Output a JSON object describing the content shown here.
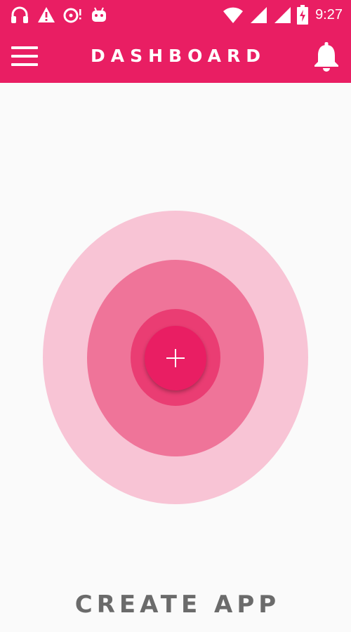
{
  "status_bar": {
    "time": "9:27",
    "icons": [
      "headphones-icon",
      "warning-icon",
      "disc-icon",
      "android-icon",
      "wifi-icon",
      "signal-icon",
      "signal-icon",
      "battery-charging-icon"
    ]
  },
  "app_bar": {
    "title": "DASHBOARD",
    "menu_icon": "menu-icon",
    "notification_icon": "bell-icon"
  },
  "main": {
    "add_button_icon": "plus-icon",
    "create_label": "CREATE APP"
  },
  "colors": {
    "primary": "#e91e63",
    "ripple_light": "#f8c4d5",
    "ripple_medium": "#ef7499",
    "ripple_dark": "#ea3d73",
    "background": "#fafafa",
    "label_text": "#6b6b6b"
  }
}
